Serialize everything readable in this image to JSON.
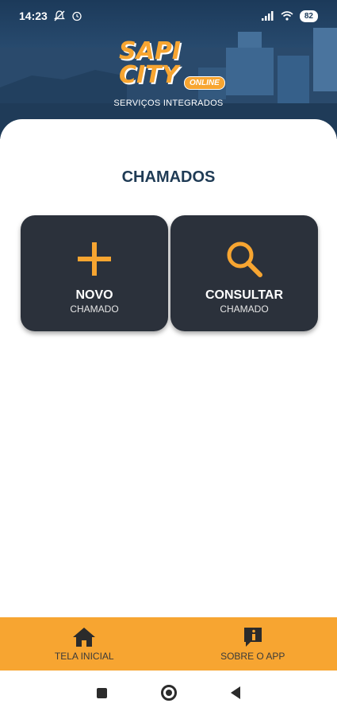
{
  "status_bar": {
    "time": "14:23",
    "battery": "82",
    "icons": [
      "notifications-off-icon",
      "alarm-icon",
      "signal-icon",
      "wifi-icon",
      "battery-icon"
    ]
  },
  "header": {
    "logo_top": "SAPI",
    "logo_bottom": "CITY",
    "logo_badge": "ONLINE",
    "subtitle": "SERVIÇOS INTEGRADOS"
  },
  "main": {
    "title": "CHAMADOS",
    "cards": [
      {
        "label": "NOVO",
        "sublabel": "CHAMADO",
        "icon": "plus-icon"
      },
      {
        "label": "CONSULTAR",
        "sublabel": "CHAMADO",
        "icon": "search-icon"
      }
    ]
  },
  "bottom_nav": {
    "items": [
      {
        "label": "TELA INICIAL",
        "icon": "home-icon"
      },
      {
        "label": "SOBRE O APP",
        "icon": "info-icon"
      }
    ]
  },
  "system_nav": {
    "icons": [
      "recents-icon",
      "home-button-icon",
      "back-icon"
    ]
  },
  "colors": {
    "accent": "#f7a531",
    "card": "#2b313b",
    "title": "#1f3b55",
    "header": "#2b4f74"
  }
}
